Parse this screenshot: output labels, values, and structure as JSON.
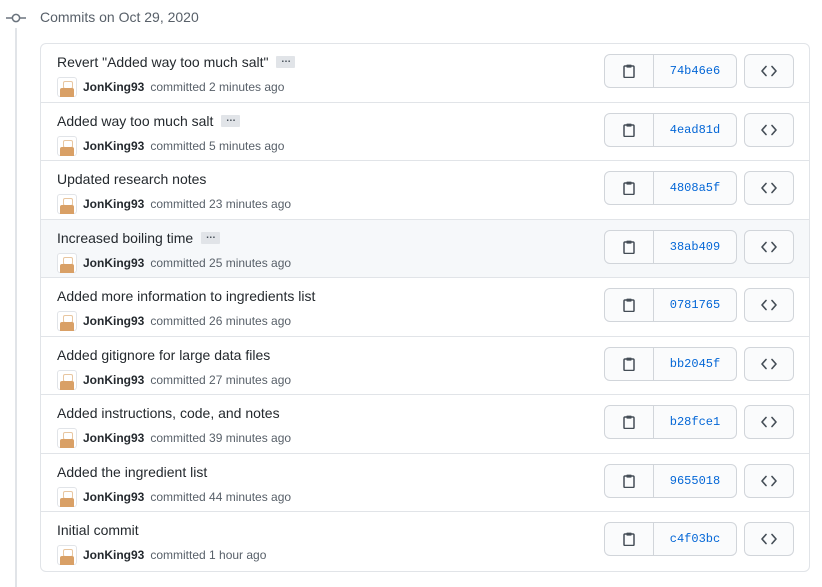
{
  "group": {
    "title": "Commits on Oct 29, 2020"
  },
  "commits": [
    {
      "message": "Revert \"Added way too much salt\"",
      "has_ellipsis": true,
      "author": "JonKing93",
      "committed": "committed 2 minutes ago",
      "sha": "74b46e6",
      "highlight": false
    },
    {
      "message": "Added way too much salt",
      "has_ellipsis": true,
      "author": "JonKing93",
      "committed": "committed 5 minutes ago",
      "sha": "4ead81d",
      "highlight": false
    },
    {
      "message": "Updated research notes",
      "has_ellipsis": false,
      "author": "JonKing93",
      "committed": "committed 23 minutes ago",
      "sha": "4808a5f",
      "highlight": false
    },
    {
      "message": "Increased boiling time",
      "has_ellipsis": true,
      "author": "JonKing93",
      "committed": "committed 25 minutes ago",
      "sha": "38ab409",
      "highlight": true
    },
    {
      "message": "Added more information to ingredients list",
      "has_ellipsis": false,
      "author": "JonKing93",
      "committed": "committed 26 minutes ago",
      "sha": "0781765",
      "highlight": false
    },
    {
      "message": "Added gitignore for large data files",
      "has_ellipsis": false,
      "author": "JonKing93",
      "committed": "committed 27 minutes ago",
      "sha": "bb2045f",
      "highlight": false
    },
    {
      "message": "Added instructions, code, and notes",
      "has_ellipsis": false,
      "author": "JonKing93",
      "committed": "committed 39 minutes ago",
      "sha": "b28fce1",
      "highlight": false
    },
    {
      "message": "Added the ingredient list",
      "has_ellipsis": false,
      "author": "JonKing93",
      "committed": "committed 44 minutes ago",
      "sha": "9655018",
      "highlight": false
    },
    {
      "message": "Initial commit",
      "has_ellipsis": false,
      "author": "JonKing93",
      "committed": "committed 1 hour ago",
      "sha": "c4f03bc",
      "highlight": false
    }
  ],
  "icons": {
    "timeline": "git-commit-icon",
    "avatar": "avatar",
    "ellipsis": "ellipsis-icon",
    "copy": "clipboard-icon",
    "browse": "code-icon"
  },
  "colors": {
    "link": "#0366d6",
    "border": "#e1e4e8",
    "muted": "#586069",
    "highlight_bg": "#f6f8fa"
  }
}
